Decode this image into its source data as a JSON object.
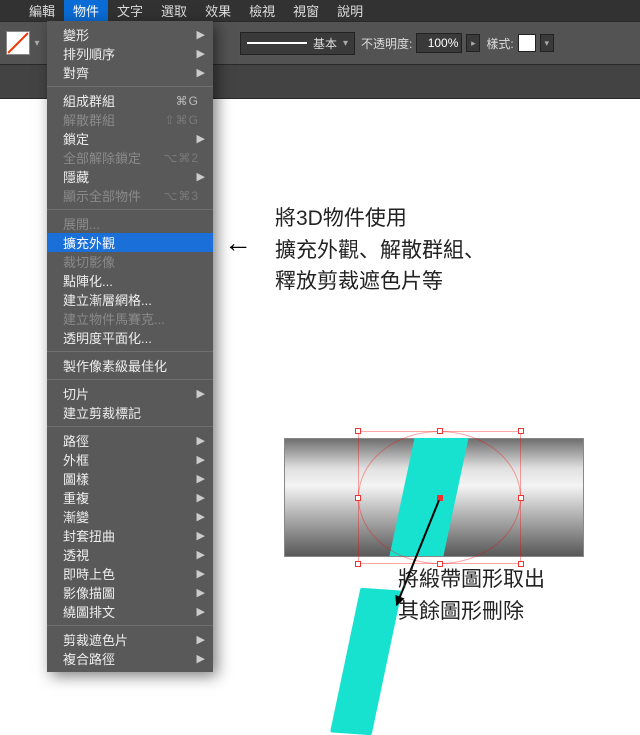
{
  "menubar": {
    "items": [
      "編輯",
      "物件",
      "文字",
      "選取",
      "效果",
      "檢視",
      "視窗",
      "說明"
    ],
    "active_index": 1
  },
  "toolbar": {
    "stroke_label": "基本",
    "opacity_label": "不透明度:",
    "opacity_value": "100%",
    "style_label": "樣式:"
  },
  "dropdown": {
    "items": [
      {
        "label": "變形",
        "submenu": true
      },
      {
        "label": "排列順序",
        "submenu": true
      },
      {
        "label": "對齊",
        "submenu": true
      },
      {
        "sep": true
      },
      {
        "label": "組成群組",
        "shortcut": "⌘G"
      },
      {
        "label": "解散群組",
        "shortcut": "⇧⌘G",
        "disabled": true
      },
      {
        "label": "鎖定",
        "submenu": true
      },
      {
        "label": "全部解除鎖定",
        "shortcut": "⌥⌘2",
        "disabled": true
      },
      {
        "label": "隱藏",
        "submenu": true
      },
      {
        "label": "顯示全部物件",
        "shortcut": "⌥⌘3",
        "disabled": true
      },
      {
        "sep": true
      },
      {
        "label": "展開...",
        "disabled": true
      },
      {
        "label": "擴充外觀",
        "highlight": true
      },
      {
        "label": "裁切影像",
        "disabled": true
      },
      {
        "label": "點陣化..."
      },
      {
        "label": "建立漸層網格..."
      },
      {
        "label": "建立物件馬賽克...",
        "disabled": true
      },
      {
        "label": "透明度平面化..."
      },
      {
        "sep": true
      },
      {
        "label": "製作像素級最佳化"
      },
      {
        "sep": true
      },
      {
        "label": "切片",
        "submenu": true
      },
      {
        "label": "建立剪裁標記"
      },
      {
        "sep": true
      },
      {
        "label": "路徑",
        "submenu": true
      },
      {
        "label": "外框",
        "submenu": true
      },
      {
        "label": "圖樣",
        "submenu": true
      },
      {
        "label": "重複",
        "submenu": true
      },
      {
        "label": "漸變",
        "submenu": true
      },
      {
        "label": "封套扭曲",
        "submenu": true
      },
      {
        "label": "透視",
        "submenu": true
      },
      {
        "label": "即時上色",
        "submenu": true
      },
      {
        "label": "影像描圖",
        "submenu": true
      },
      {
        "label": "繞圖排文",
        "submenu": true
      },
      {
        "sep": true
      },
      {
        "label": "剪裁遮色片",
        "submenu": true
      },
      {
        "label": "複合路徑",
        "submenu": true
      }
    ]
  },
  "annotations": {
    "top1": "將3D物件使用",
    "top2": "擴充外觀、解散群組、",
    "top3": "釋放剪裁遮色片等",
    "bot1": "將緞帶圖形取出",
    "bot2": "其餘圖形刪除"
  }
}
